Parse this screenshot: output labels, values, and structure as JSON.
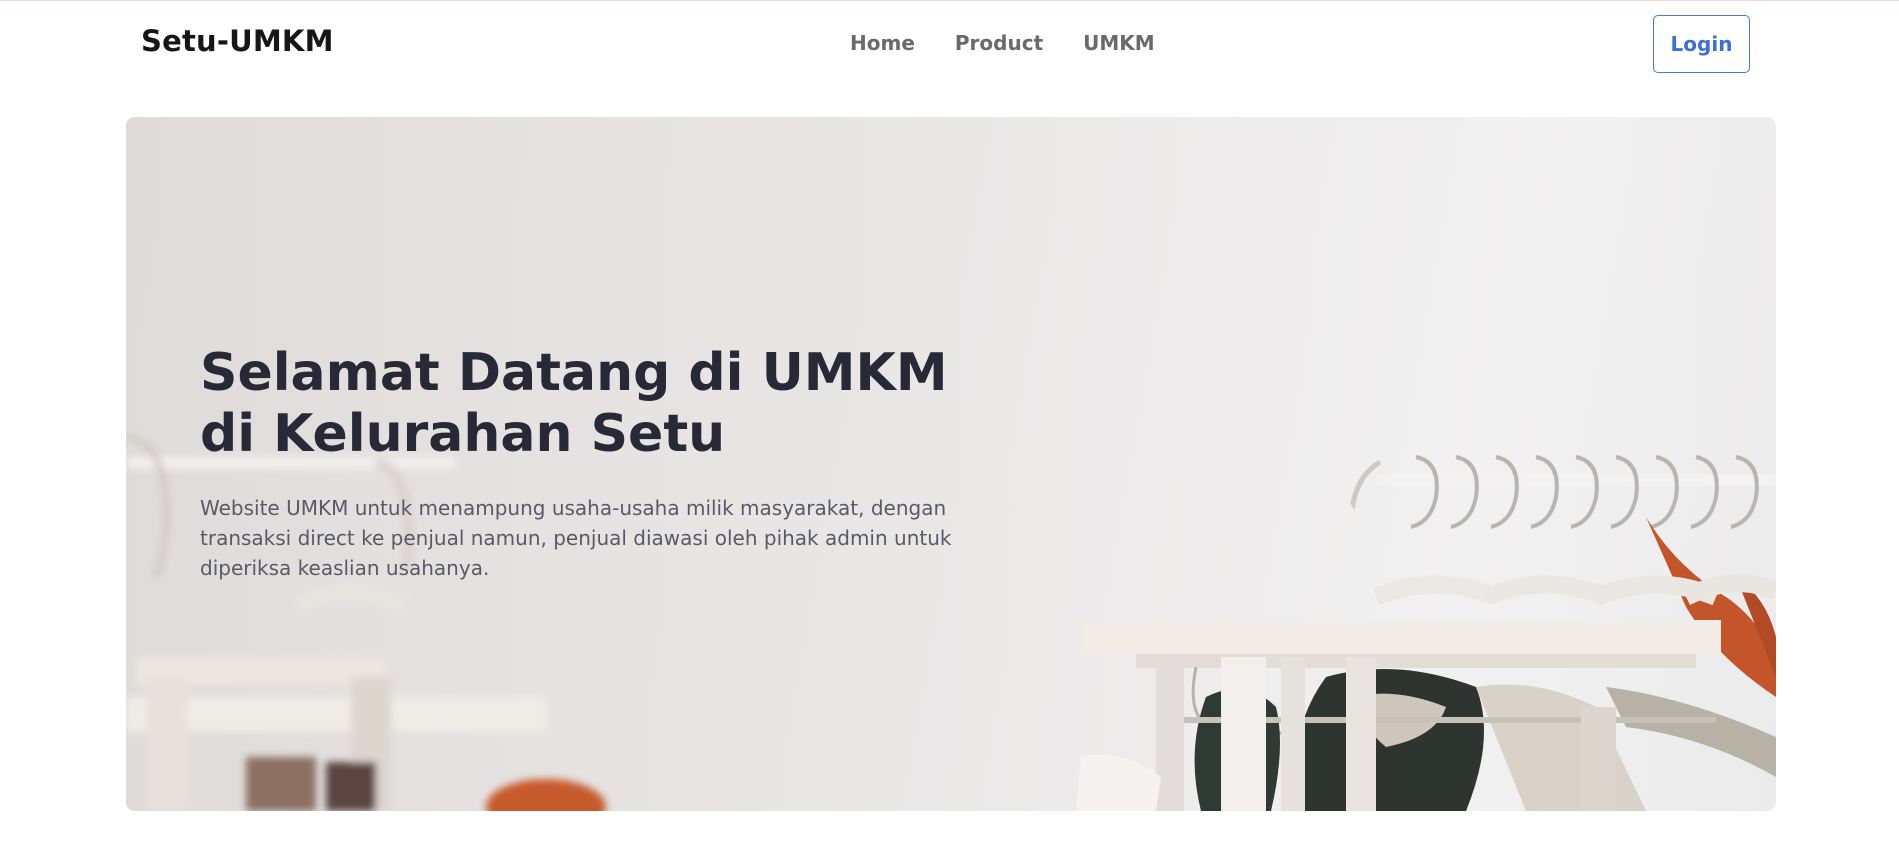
{
  "navbar": {
    "brand": "Setu-UMKM",
    "links": [
      {
        "label": "Home"
      },
      {
        "label": "Product"
      },
      {
        "label": "UMKM"
      }
    ],
    "login_label": "Login"
  },
  "hero": {
    "title_line1": "Selamat Datang di UMKM",
    "title_line2": "di Kelurahan Setu",
    "description": "Website UMKM untuk menampung usaha-usaha milik masyarakat, dengan transaksi direct ke penjual namun, penjual diawasi oleh pihak admin untuk diperiksa keaslian usahanya.",
    "background_image": "clothes-rack-with-hangers"
  },
  "colors": {
    "accent": "#3d6fd6",
    "heading": "#272a36",
    "body_text": "#575a68",
    "nav_text": "#6a6a6a"
  }
}
